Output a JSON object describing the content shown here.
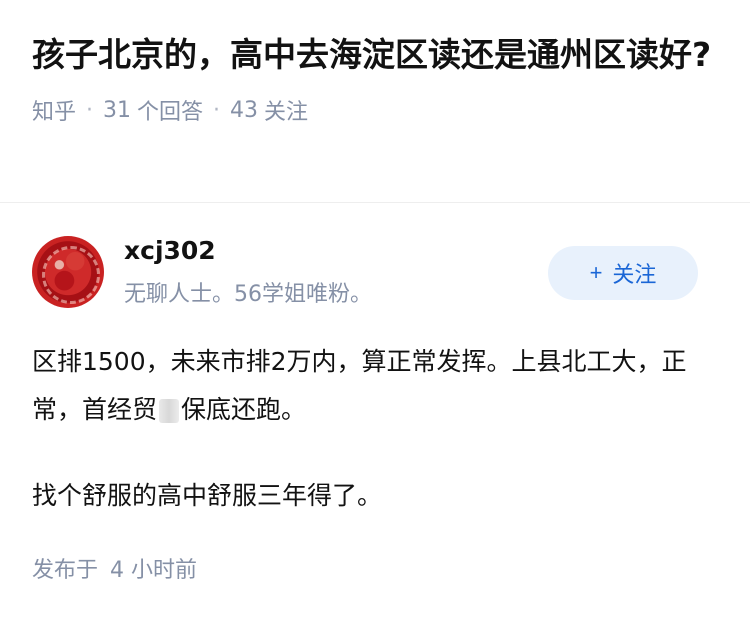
{
  "question": {
    "title": "孩子北京的，高中去海淀区读还是通州区读好?",
    "source": "知乎",
    "answer_count": "31",
    "answer_label": "个回答",
    "follow_count": "43",
    "follow_label": "关注"
  },
  "author": {
    "name": "xcj302",
    "bio": "无聊人士。56学姐唯粉。",
    "follow_button": "关注",
    "avatar_icon": "avatar-red-pattern"
  },
  "answer": {
    "para1_before": "区排1500，未来市排2万内，算正常发挥。上县北工大，正常，首经贸",
    "para1_after": "保底还跑。",
    "para2": "找个舒服的高中舒服三年得了。"
  },
  "footer": {
    "published_label": "发布于",
    "time": "4 小时前"
  },
  "colors": {
    "accent": "#1a66d6",
    "follow_bg": "#e8f1fc",
    "meta": "#8590a6"
  }
}
